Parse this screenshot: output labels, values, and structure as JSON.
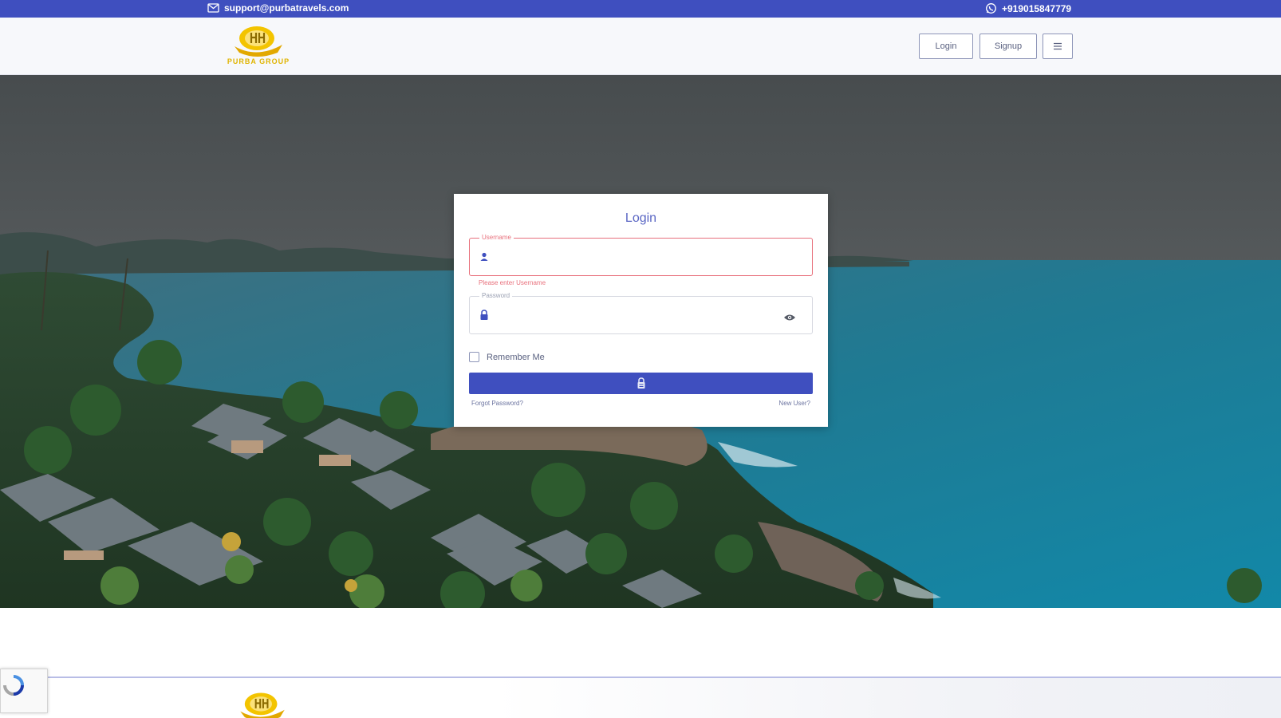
{
  "topbar": {
    "email": "support@purbatravels.com",
    "phone": "+919015847779"
  },
  "header": {
    "logo_text": "PURBA GROUP",
    "login_label": "Login",
    "signup_label": "Signup",
    "menu_icon": "menu-icon"
  },
  "login_card": {
    "title": "Login",
    "username_label": "Username",
    "username_value": "",
    "username_error": "Please enter Username",
    "password_label": "Password",
    "password_value": "",
    "remember_label": "Remember Me",
    "forgot_link": "Forgot Password?",
    "new_user_link": "New User?"
  },
  "colors": {
    "brand_blue": "#3f4fbf",
    "error_red": "#e8707c",
    "logo_gold": "#e0b400"
  }
}
